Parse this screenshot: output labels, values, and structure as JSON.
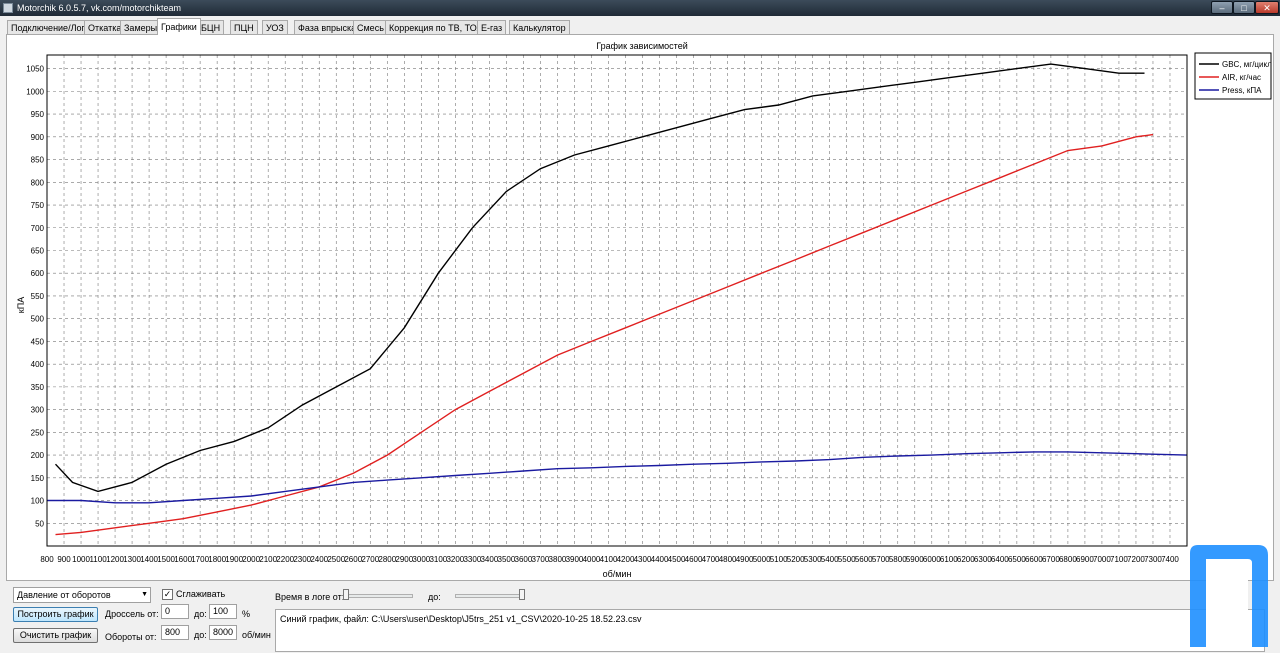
{
  "window": {
    "title": "Motorchik 6.0.5.7, vk.com/motorchikteam",
    "min": "–",
    "max": "□",
    "close": "✕"
  },
  "tabs": [
    "Подключение/Лог",
    "Откатка",
    "Замеры",
    "Графики",
    "БЦН",
    "ПЦН",
    "УОЗ",
    "Фаза впрыска",
    "Смесь",
    "Коррекция по ТВ, ТОЖ",
    "Е-газ",
    "Калькулятор"
  ],
  "active_tab": "Графики",
  "chart_data": {
    "type": "line",
    "title": "График зависимостей",
    "xlabel": "об/мин",
    "ylabel": "кПА",
    "xlim": [
      800,
      7500
    ],
    "ylim": [
      0,
      1080
    ],
    "x_ticks": [
      800,
      900,
      1000,
      1100,
      1200,
      1300,
      1400,
      1500,
      1600,
      1700,
      1800,
      1900,
      2000,
      2100,
      2200,
      2300,
      2400,
      2500,
      2600,
      2700,
      2800,
      2900,
      3000,
      3100,
      3200,
      3300,
      3400,
      3500,
      3600,
      3700,
      3800,
      3900,
      4000,
      4100,
      4200,
      4300,
      4400,
      4500,
      4600,
      4700,
      4800,
      4900,
      5000,
      5100,
      5200,
      5300,
      5400,
      5500,
      5600,
      5700,
      5800,
      5900,
      6000,
      6100,
      6200,
      6300,
      6400,
      6500,
      6600,
      6700,
      6800,
      6900,
      7000,
      7100,
      7200,
      7300,
      7400
    ],
    "y_ticks": [
      50,
      100,
      150,
      200,
      250,
      300,
      350,
      400,
      450,
      500,
      550,
      600,
      650,
      700,
      750,
      800,
      850,
      900,
      950,
      1000,
      1050
    ],
    "grid": true,
    "legend_position": "top-right",
    "series": [
      {
        "name": "GBC, мг/цикл",
        "color": "#000000",
        "x": [
          850,
          950,
          1100,
          1300,
          1500,
          1700,
          1900,
          2100,
          2300,
          2500,
          2700,
          2900,
          3100,
          3300,
          3500,
          3700,
          3900,
          4100,
          4300,
          4500,
          4700,
          4900,
          5100,
          5300,
          5500,
          5700,
          5900,
          6100,
          6300,
          6500,
          6700,
          6900,
          7100,
          7250
        ],
        "y": [
          180,
          140,
          120,
          140,
          180,
          210,
          230,
          260,
          310,
          350,
          390,
          480,
          600,
          700,
          780,
          830,
          860,
          880,
          900,
          920,
          940,
          960,
          970,
          990,
          1000,
          1010,
          1020,
          1030,
          1040,
          1050,
          1060,
          1050,
          1040,
          1040
        ]
      },
      {
        "name": "AIR, кг/час",
        "color": "#e02020",
        "x": [
          850,
          1000,
          1200,
          1400,
          1600,
          1800,
          2000,
          2200,
          2400,
          2600,
          2800,
          3000,
          3200,
          3400,
          3600,
          3800,
          4000,
          4200,
          4400,
          4600,
          4800,
          5000,
          5200,
          5400,
          5600,
          5800,
          6000,
          6200,
          6400,
          6600,
          6800,
          7000,
          7200,
          7300
        ],
        "y": [
          25,
          30,
          40,
          50,
          60,
          75,
          90,
          110,
          130,
          160,
          200,
          250,
          300,
          340,
          380,
          420,
          450,
          480,
          510,
          540,
          570,
          600,
          630,
          660,
          690,
          720,
          750,
          780,
          810,
          840,
          870,
          880,
          900,
          905
        ]
      },
      {
        "name": "Press, кПА",
        "color": "#1a1aa0",
        "x": [
          800,
          1000,
          1200,
          1400,
          1600,
          1800,
          2000,
          2200,
          2400,
          2600,
          2800,
          3000,
          3200,
          3400,
          3600,
          3800,
          4000,
          4200,
          4400,
          4600,
          4800,
          5000,
          5200,
          5400,
          5600,
          5800,
          6000,
          6200,
          6400,
          6600,
          6800,
          7000,
          7200,
          7500
        ],
        "y": [
          100,
          100,
          95,
          95,
          100,
          105,
          110,
          120,
          130,
          140,
          145,
          150,
          155,
          160,
          165,
          170,
          172,
          175,
          177,
          180,
          182,
          185,
          187,
          190,
          195,
          198,
          200,
          203,
          205,
          207,
          207,
          205,
          203,
          200
        ]
      }
    ]
  },
  "controls": {
    "mode_select": "Давление от оборотов",
    "smooth_checkbox_label": "Сглаживать",
    "smooth_checked": "✓",
    "build_button": "Построить график",
    "clear_button": "Очистить график",
    "throttle_from_label": "Дроссель от:",
    "throttle_from": "0",
    "throttle_to_label": "до:",
    "throttle_to": "100",
    "throttle_unit": "%",
    "rpm_from_label": "Обороты от:",
    "rpm_from": "800",
    "rpm_to_label": "до:",
    "rpm_to": "8000",
    "rpm_unit": "об/мин",
    "time_from_label": "Время в логе от:",
    "time_to_label": "до:",
    "time_from_position": 0,
    "time_to_position": 1
  },
  "status_text": "Синий график, файл: C:\\Users\\user\\Desktop\\J5trs_251 v1_CSV\\2020-10-25 18.52.23.csv"
}
